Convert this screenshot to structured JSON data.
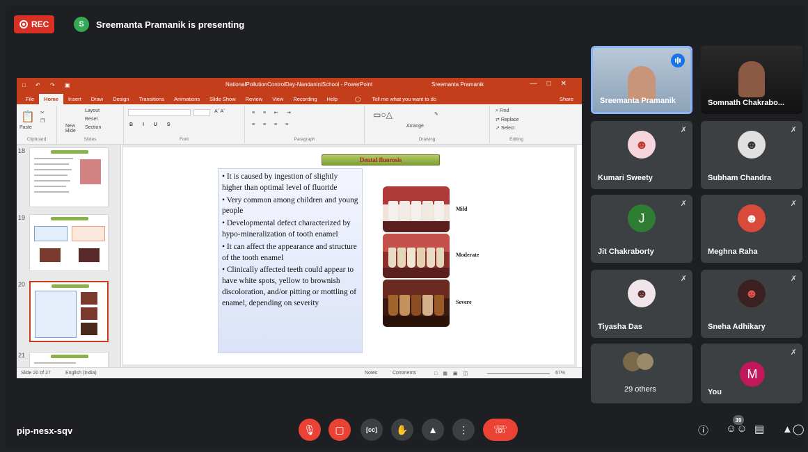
{
  "top_bar": {
    "rec_label": "REC",
    "presenter_initial": "S",
    "presenter_text": "Sreemanta Pramanik is presenting"
  },
  "ppt": {
    "doc_title": "NationalPollutionControlDay-NandaniniSchool  -  PowerPoint",
    "user_name": "Sreemanta Pramanik",
    "tabs": [
      "File",
      "Home",
      "Insert",
      "Draw",
      "Design",
      "Transitions",
      "Animations",
      "Slide Show",
      "Review",
      "View",
      "Recording",
      "Help"
    ],
    "tell_me": "Tell me what you want to do",
    "share": "Share",
    "ribbon_groups": {
      "clipboard": "Clipboard",
      "slides": "Slides",
      "font": "Font",
      "paragraph": "Paragraph",
      "drawing": "Drawing",
      "editing": "Editing"
    },
    "ribbon_items": {
      "paste": "Paste",
      "new_slide": "New Slide",
      "layout": "Layout",
      "reset": "Reset",
      "section": "Section",
      "arrange": "Arrange",
      "find": "Find",
      "replace": "Replace",
      "select": "Select"
    },
    "thumb_numbers": [
      "18",
      "19",
      "20",
      "21"
    ],
    "slide": {
      "title": "Dental fluorosis",
      "bullets": [
        "• It is caused by ingestion of slightly higher than optimal level of fluoride",
        "• Very common among children and young people",
        "• Developmental defect characterized by hypo-mineralization of tooth enamel",
        "• It can affect the appearance and structure of the tooth enamel",
        "• Clinically affected teeth could appear to have white spots, yellow to brownish discoloration, and/or pitting or mottling of enamel, depending on severity"
      ],
      "labels": [
        "Mild",
        "Moderate",
        "Severe"
      ]
    },
    "status": {
      "slide_count": "Slide 20 of 27",
      "language": "English (India)",
      "notes": "Notes",
      "comments": "Comments",
      "zoom": "67%"
    }
  },
  "participants": [
    {
      "name": "Sreemanta Pramanik",
      "muted": false,
      "speaking": true
    },
    {
      "name": "Somnath Chakrabo...",
      "muted": false
    },
    {
      "name": "Kumari Sweety",
      "muted": true
    },
    {
      "name": "Subham Chandra",
      "muted": true
    },
    {
      "name": "Jit Chakraborty",
      "muted": true,
      "initial": "J"
    },
    {
      "name": "Meghna Raha",
      "muted": true
    },
    {
      "name": "Tiyasha Das",
      "muted": true
    },
    {
      "name": "Sneha Adhikary",
      "muted": true
    },
    {
      "name": "29 others"
    },
    {
      "name": "You",
      "muted": true,
      "initial": "M"
    }
  ],
  "bottom_bar": {
    "meeting_code": "pip-nesx-sqv",
    "people_count": "39"
  },
  "colors": {
    "background": "#202124",
    "tile": "#3c4043",
    "red": "#ea4335",
    "ppt_accent": "#c43e1c",
    "active_speaker": "#8ab4f8"
  }
}
